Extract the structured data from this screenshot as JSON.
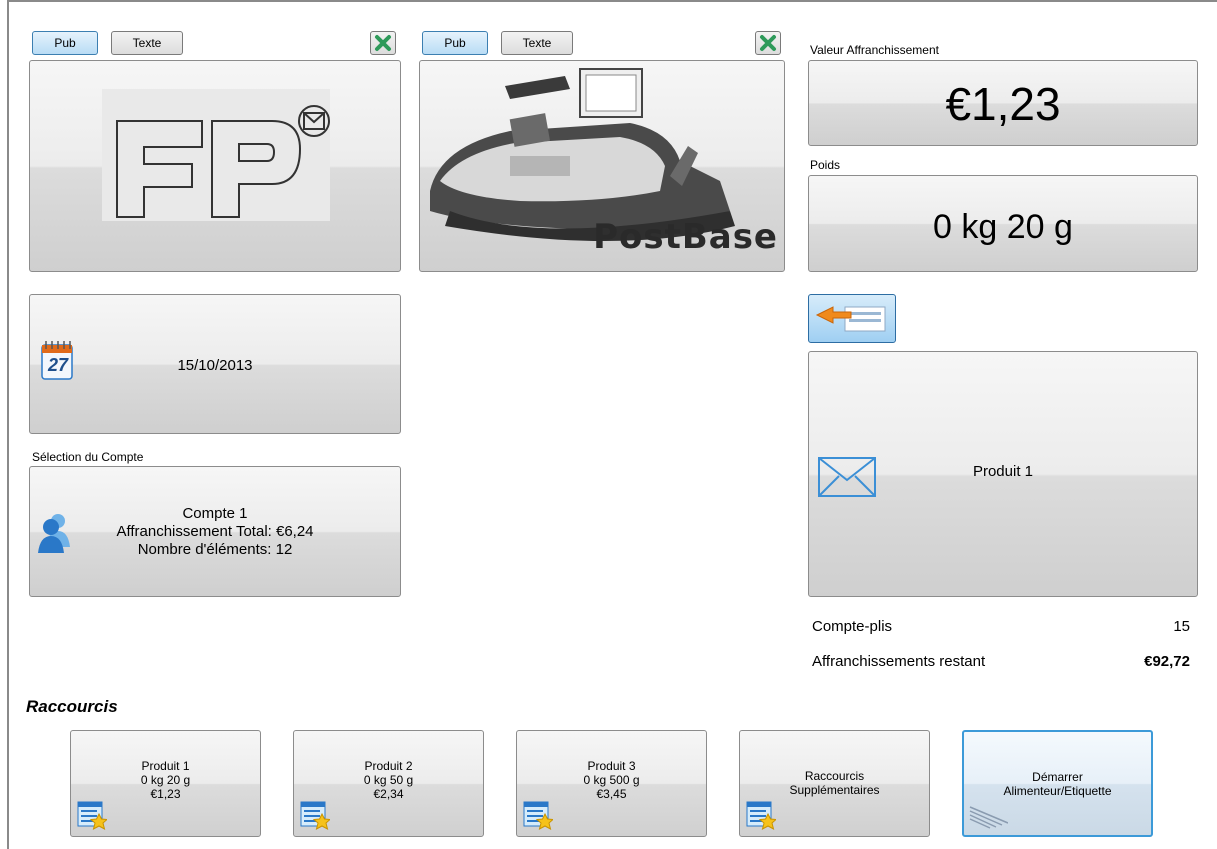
{
  "panel1": {
    "pub_label": "Pub",
    "texte_label": "Texte"
  },
  "panel2": {
    "pub_label": "Pub",
    "texte_label": "Texte",
    "brand_text": "PostBase"
  },
  "valeur": {
    "label": "Valeur Affranchissement",
    "value": "€1,23"
  },
  "poids": {
    "label": "Poids",
    "value": "0 kg 20 g"
  },
  "date": {
    "value": "15/10/2013",
    "icon_day": "27"
  },
  "compte": {
    "label": "Sélection du Compte",
    "name": "Compte 1",
    "total": "Affranchissement Total: €6,24",
    "count": "Nombre d'éléments: 12"
  },
  "produit": {
    "label": "Produit 1"
  },
  "counters": {
    "compte_plis_label": "Compte-plis",
    "compte_plis_value": "15",
    "restant_label": "Affranchissements restant",
    "restant_value": "€92,72"
  },
  "shortcuts": {
    "title": "Raccourcis",
    "items": [
      {
        "line1": "Produit 1",
        "line2": "0 kg 20 g",
        "line3": "€1,23"
      },
      {
        "line1": "Produit 2",
        "line2": "0 kg 50 g",
        "line3": "€2,34"
      },
      {
        "line1": "Produit 3",
        "line2": "0 kg 500 g",
        "line3": "€3,45"
      },
      {
        "line1": "Raccourcis",
        "line2": "Supplémentaires"
      },
      {
        "line1": "Démarrer",
        "line2": "Alimenteur/Etiquette"
      }
    ]
  },
  "colors": {
    "accent": "#3c7fb1",
    "icon_blue": "#2a78c8",
    "close_green": "#2e9a5a"
  }
}
